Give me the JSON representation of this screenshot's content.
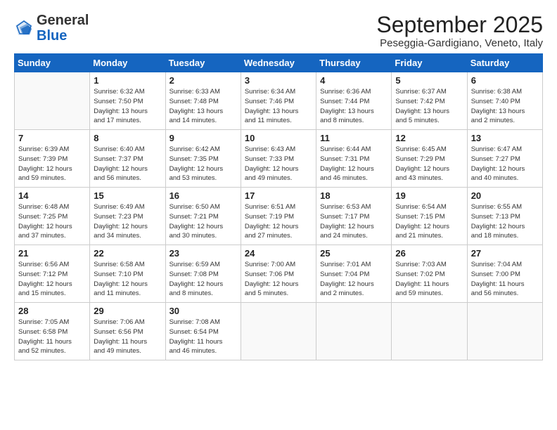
{
  "header": {
    "logo_general": "General",
    "logo_blue": "Blue",
    "month_title": "September 2025",
    "location": "Peseggia-Gardigiano, Veneto, Italy"
  },
  "days_of_week": [
    "Sunday",
    "Monday",
    "Tuesday",
    "Wednesday",
    "Thursday",
    "Friday",
    "Saturday"
  ],
  "weeks": [
    [
      {
        "day": "",
        "info": ""
      },
      {
        "day": "1",
        "info": "Sunrise: 6:32 AM\nSunset: 7:50 PM\nDaylight: 13 hours\nand 17 minutes."
      },
      {
        "day": "2",
        "info": "Sunrise: 6:33 AM\nSunset: 7:48 PM\nDaylight: 13 hours\nand 14 minutes."
      },
      {
        "day": "3",
        "info": "Sunrise: 6:34 AM\nSunset: 7:46 PM\nDaylight: 13 hours\nand 11 minutes."
      },
      {
        "day": "4",
        "info": "Sunrise: 6:36 AM\nSunset: 7:44 PM\nDaylight: 13 hours\nand 8 minutes."
      },
      {
        "day": "5",
        "info": "Sunrise: 6:37 AM\nSunset: 7:42 PM\nDaylight: 13 hours\nand 5 minutes."
      },
      {
        "day": "6",
        "info": "Sunrise: 6:38 AM\nSunset: 7:40 PM\nDaylight: 13 hours\nand 2 minutes."
      }
    ],
    [
      {
        "day": "7",
        "info": "Sunrise: 6:39 AM\nSunset: 7:39 PM\nDaylight: 12 hours\nand 59 minutes."
      },
      {
        "day": "8",
        "info": "Sunrise: 6:40 AM\nSunset: 7:37 PM\nDaylight: 12 hours\nand 56 minutes."
      },
      {
        "day": "9",
        "info": "Sunrise: 6:42 AM\nSunset: 7:35 PM\nDaylight: 12 hours\nand 53 minutes."
      },
      {
        "day": "10",
        "info": "Sunrise: 6:43 AM\nSunset: 7:33 PM\nDaylight: 12 hours\nand 49 minutes."
      },
      {
        "day": "11",
        "info": "Sunrise: 6:44 AM\nSunset: 7:31 PM\nDaylight: 12 hours\nand 46 minutes."
      },
      {
        "day": "12",
        "info": "Sunrise: 6:45 AM\nSunset: 7:29 PM\nDaylight: 12 hours\nand 43 minutes."
      },
      {
        "day": "13",
        "info": "Sunrise: 6:47 AM\nSunset: 7:27 PM\nDaylight: 12 hours\nand 40 minutes."
      }
    ],
    [
      {
        "day": "14",
        "info": "Sunrise: 6:48 AM\nSunset: 7:25 PM\nDaylight: 12 hours\nand 37 minutes."
      },
      {
        "day": "15",
        "info": "Sunrise: 6:49 AM\nSunset: 7:23 PM\nDaylight: 12 hours\nand 34 minutes."
      },
      {
        "day": "16",
        "info": "Sunrise: 6:50 AM\nSunset: 7:21 PM\nDaylight: 12 hours\nand 30 minutes."
      },
      {
        "day": "17",
        "info": "Sunrise: 6:51 AM\nSunset: 7:19 PM\nDaylight: 12 hours\nand 27 minutes."
      },
      {
        "day": "18",
        "info": "Sunrise: 6:53 AM\nSunset: 7:17 PM\nDaylight: 12 hours\nand 24 minutes."
      },
      {
        "day": "19",
        "info": "Sunrise: 6:54 AM\nSunset: 7:15 PM\nDaylight: 12 hours\nand 21 minutes."
      },
      {
        "day": "20",
        "info": "Sunrise: 6:55 AM\nSunset: 7:13 PM\nDaylight: 12 hours\nand 18 minutes."
      }
    ],
    [
      {
        "day": "21",
        "info": "Sunrise: 6:56 AM\nSunset: 7:12 PM\nDaylight: 12 hours\nand 15 minutes."
      },
      {
        "day": "22",
        "info": "Sunrise: 6:58 AM\nSunset: 7:10 PM\nDaylight: 12 hours\nand 11 minutes."
      },
      {
        "day": "23",
        "info": "Sunrise: 6:59 AM\nSunset: 7:08 PM\nDaylight: 12 hours\nand 8 minutes."
      },
      {
        "day": "24",
        "info": "Sunrise: 7:00 AM\nSunset: 7:06 PM\nDaylight: 12 hours\nand 5 minutes."
      },
      {
        "day": "25",
        "info": "Sunrise: 7:01 AM\nSunset: 7:04 PM\nDaylight: 12 hours\nand 2 minutes."
      },
      {
        "day": "26",
        "info": "Sunrise: 7:03 AM\nSunset: 7:02 PM\nDaylight: 11 hours\nand 59 minutes."
      },
      {
        "day": "27",
        "info": "Sunrise: 7:04 AM\nSunset: 7:00 PM\nDaylight: 11 hours\nand 56 minutes."
      }
    ],
    [
      {
        "day": "28",
        "info": "Sunrise: 7:05 AM\nSunset: 6:58 PM\nDaylight: 11 hours\nand 52 minutes."
      },
      {
        "day": "29",
        "info": "Sunrise: 7:06 AM\nSunset: 6:56 PM\nDaylight: 11 hours\nand 49 minutes."
      },
      {
        "day": "30",
        "info": "Sunrise: 7:08 AM\nSunset: 6:54 PM\nDaylight: 11 hours\nand 46 minutes."
      },
      {
        "day": "",
        "info": ""
      },
      {
        "day": "",
        "info": ""
      },
      {
        "day": "",
        "info": ""
      },
      {
        "day": "",
        "info": ""
      }
    ]
  ]
}
